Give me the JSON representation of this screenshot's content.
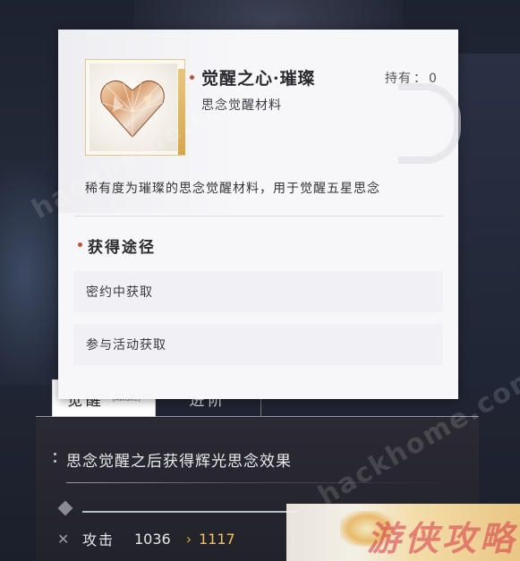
{
  "popup": {
    "item_name": "觉醒之心·璀璨",
    "item_type": "思念觉醒材料",
    "held_label": "持有",
    "held_value": "0",
    "description": "稀有度为璀璨的思念觉醒材料，用于觉醒五星思念",
    "sources_title": "获得途径",
    "sources": [
      {
        "label": "密约中获取"
      },
      {
        "label": "参与活动获取"
      }
    ],
    "icon": "crystal-heart-icon"
  },
  "tabs": [
    {
      "label": "觉醒",
      "sub": "(Awake)",
      "active": true
    },
    {
      "label": "进阶",
      "active": false
    }
  ],
  "effect": {
    "text": "思念觉醒之后获得辉光思念效果"
  },
  "stat": {
    "label": "攻击",
    "old_value": "1036",
    "arrow": "›",
    "new_value": "1117"
  },
  "watermark": {
    "site": "hackhome.com",
    "corner_text": "游侠攻略"
  },
  "colors": {
    "accent_dot": "#c0503a",
    "stat_new": "#f0c060",
    "frame_gold": "#e2c78a"
  }
}
